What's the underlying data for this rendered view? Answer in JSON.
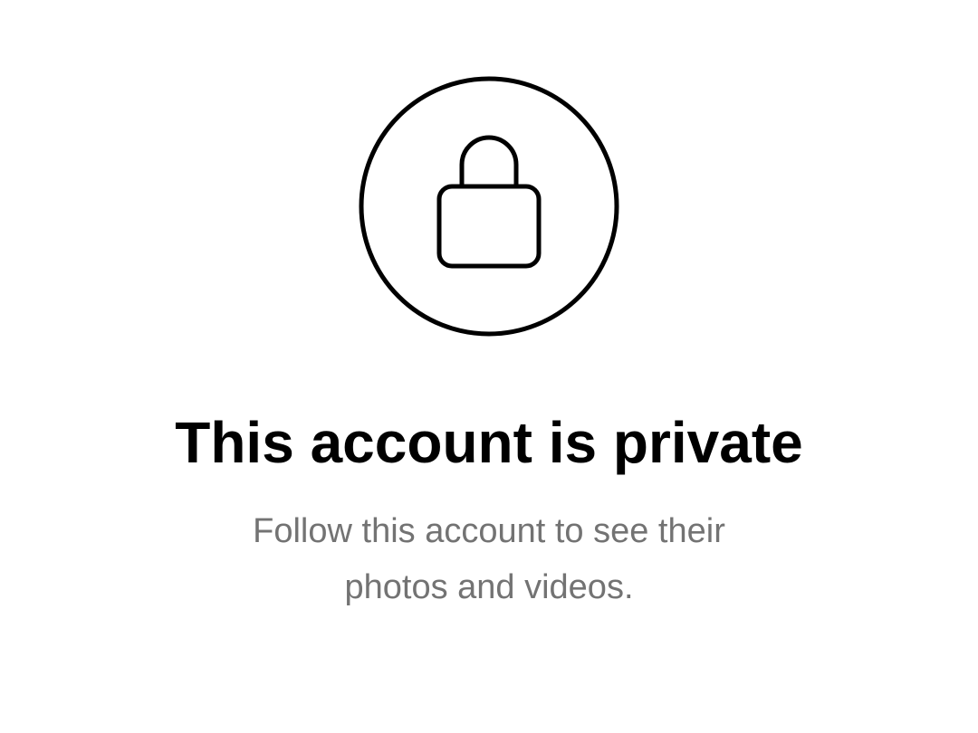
{
  "private_state": {
    "icon": "lock-icon",
    "title": "This account is private",
    "message": "Follow this account to see their photos and videos."
  },
  "colors": {
    "background": "#ffffff",
    "title": "#000000",
    "message": "#737373",
    "icon_stroke": "#000000"
  }
}
